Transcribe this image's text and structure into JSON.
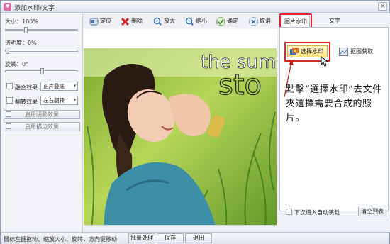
{
  "window": {
    "title": "添加水印/文字",
    "app_icon_glyph": "♥",
    "close_glyph": "×"
  },
  "left_panel": {
    "size_label": "大小：100%",
    "size_value_pct": 100,
    "opacity_label": "透明度：0%",
    "opacity_value_pct": 0,
    "rotation_label": "旋转：0°",
    "rotation_value_deg": 0,
    "blend_label": "融合效果",
    "blend_value": "正片叠底",
    "flip_label": "翻转效果",
    "flip_value": "左右翻转",
    "shadow_button": "启用阴影效果",
    "stroke_button": "启用描边效果"
  },
  "toolbar": {
    "position": "定位",
    "delete": "删除",
    "zoom_in": "放大",
    "zoom_out": "缩小",
    "confirm": "确定",
    "cancel": "取消"
  },
  "photo": {
    "watermark_line1": "the sum",
    "watermark_line2": "sto"
  },
  "right_panel": {
    "tab_picture": "图片水印",
    "tab_text": "文字",
    "select_watermark": "选择水印",
    "capture": "抠图获取",
    "instruction": "點擊“選擇水印”去文件夾選擇需要合成的照片。",
    "auto_load_label": "下次进入自动装载",
    "clear_list": "清空列表"
  },
  "statusbar": {
    "hint": "鼠标左键拖动、缩放大小、旋转，方向键移动",
    "batch": "批量处理",
    "btn2": "保存",
    "btn3": "退出"
  },
  "colors": {
    "highlight_red": "#e0242a",
    "accent_blue": "#3b6fb5",
    "select_yellow": "#ffe07a"
  }
}
